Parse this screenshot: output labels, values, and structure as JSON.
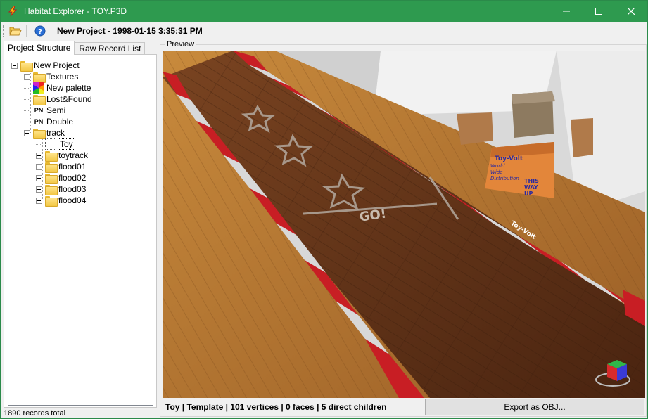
{
  "window": {
    "title": "Habitat Explorer - TOY.P3D",
    "controls": {
      "minimize": "─",
      "maximize": "☐",
      "close": "✕"
    }
  },
  "toolbar": {
    "open_icon": "folder-open-icon",
    "help_icon": "help-icon",
    "project_label": "New Project - 1998-01-15 3:35:31 PM"
  },
  "tabs": [
    {
      "label": "Project Structure",
      "active": true
    },
    {
      "label": "Raw Record List",
      "active": false
    }
  ],
  "tree": {
    "root": "New Project",
    "items": [
      {
        "label": "Textures",
        "icon": "folder-icon"
      },
      {
        "label": "New palette",
        "icon": "palette-icon"
      },
      {
        "label": "Lost&Found",
        "icon": "folder-icon"
      },
      {
        "label": "Semi",
        "icon": "pn-icon",
        "badge": "PN"
      },
      {
        "label": "Double",
        "icon": "pn-icon",
        "badge": "PN"
      },
      {
        "label": "track",
        "icon": "folder-icon"
      }
    ],
    "track_children": [
      {
        "label": "Toy",
        "icon": "model-icon",
        "selected": true
      },
      {
        "label": "toytrack",
        "icon": "folder-icon"
      },
      {
        "label": "flood01",
        "icon": "folder-icon"
      },
      {
        "label": "flood02",
        "icon": "folder-icon"
      },
      {
        "label": "flood03",
        "icon": "folder-icon"
      },
      {
        "label": "flood04",
        "icon": "folder-icon"
      }
    ]
  },
  "status": {
    "records": "1890 records total"
  },
  "preview": {
    "legend": "Preview",
    "scene_text": {
      "go_label": "GO!",
      "brand_a": "Toy-Volt",
      "box_lines": [
        "Toy-Volt",
        "World",
        "Wide",
        "Distribution",
        "THIS",
        "WAY",
        "UP"
      ]
    },
    "info": "Toy | Template | 101 vertices | 0 faces | 5 direct children",
    "export_label": "Export as OBJ..."
  },
  "colors": {
    "titlebar": "#2e9a4f",
    "track_wood": "#6b3a1c",
    "floor_wood": "#b3732f",
    "curb_red": "#c81e24",
    "curb_white": "#d8d8d8"
  }
}
